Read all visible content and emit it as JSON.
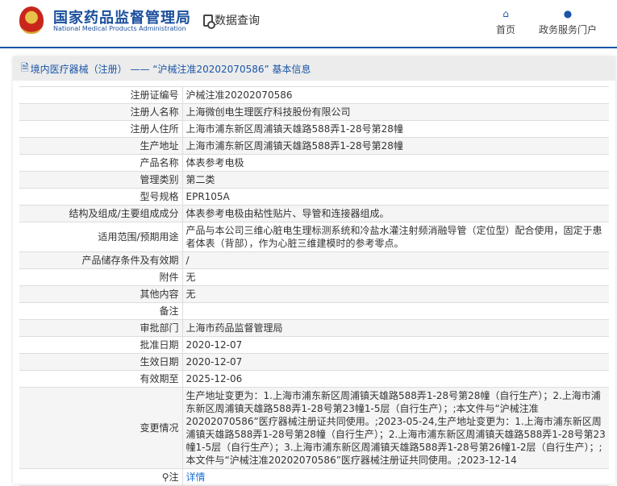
{
  "header": {
    "logo_cn": "国家药品监督管理局",
    "logo_en": "National Medical Products Administration",
    "data_query": "数据查询",
    "nav": [
      {
        "label": "首页",
        "icon": "home-icon"
      },
      {
        "label": "政务服务门户",
        "icon": "user-icon"
      }
    ]
  },
  "panel": {
    "title": "境内医疗器械（注册） ——  “沪械注准20202070586” 基本信息"
  },
  "rows": [
    {
      "label": "注册证编号",
      "value": "沪械注准20202070586"
    },
    {
      "label": "注册人名称",
      "value": "上海微创电生理医疗科技股份有限公司"
    },
    {
      "label": "注册人住所",
      "value": "上海市浦东新区周浦镇天雄路588弄1-28号第28幢"
    },
    {
      "label": "生产地址",
      "value": "上海市浦东新区周浦镇天雄路588弄1-28号第28幢"
    },
    {
      "label": "产品名称",
      "value": "体表参考电极"
    },
    {
      "label": "管理类别",
      "value": "第二类"
    },
    {
      "label": "型号规格",
      "value": "EPR105A"
    },
    {
      "label": "结构及组成/主要组成成分",
      "value": "体表参考电极由粘性贴片、导管和连接器组成。"
    },
    {
      "label": "适用范围/预期用途",
      "value": "产品与本公司三维心脏电生理标测系统和冷盐水灌注射频消融导管（定位型）配合使用，固定于患者体表（背部），作为心脏三维建模时的参考零点。"
    },
    {
      "label": "产品储存条件及有效期",
      "value": "/"
    },
    {
      "label": "附件",
      "value": "无"
    },
    {
      "label": "其他内容",
      "value": "无"
    },
    {
      "label": "备注",
      "value": ""
    },
    {
      "label": "审批部门",
      "value": "上海市药品监督管理局"
    },
    {
      "label": "批准日期",
      "value": "2020-12-07"
    },
    {
      "label": "生效日期",
      "value": "2020-12-07"
    },
    {
      "label": "有效期至",
      "value": "2025-12-06"
    },
    {
      "label": "变更情况",
      "value": "生产地址变更为：1.上海市浦东新区周浦镇天雄路588弄1-28号第28幢（自行生产）；2.上海市浦东新区周浦镇天雄路588弄1-28号第23幢1-5层（自行生产）；;本文件与“沪械注准20202070586”医疗器械注册证共同使用。;2023-05-24,生产地址变更为：1.上海市浦东新区周浦镇天雄路588弄1-28号第28幢（自行生产）；2.上海市浦东新区周浦镇天雄路588弄1-28号第23幢1-5层（自行生产）；3.上海市浦东新区周浦镇天雄路588弄1-28号第26幢1-2层（自行生产）；;本文件与“沪械注准20202070586”医疗器械注册证共同使用。;2023-12-14"
    }
  ],
  "note": {
    "label": "注",
    "link": "详情"
  }
}
